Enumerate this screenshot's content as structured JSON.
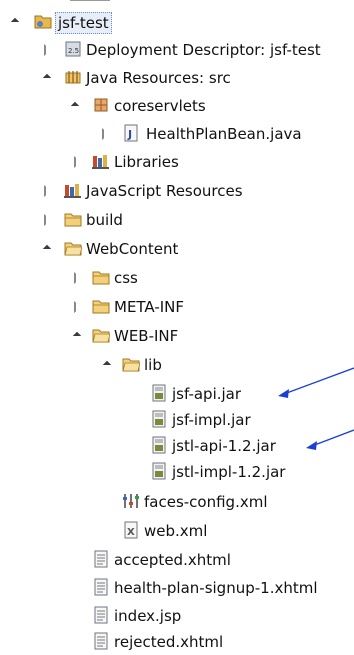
{
  "tree": {
    "project": "jsf-test",
    "deployment_descriptor": "Deployment Descriptor: jsf-test",
    "java_resources": "Java Resources: src",
    "package": "coreservlets",
    "java_file": "HealthPlanBean.java",
    "libraries": "Libraries",
    "js_resources": "JavaScript Resources",
    "build": "build",
    "webcontent": "WebContent",
    "css": "css",
    "meta_inf": "META-INF",
    "web_inf": "WEB-INF",
    "lib": "lib",
    "jars": [
      "jsf-api.jar",
      "jsf-impl.jar",
      "jstl-api-1.2.jar",
      "jstl-impl-1.2.jar"
    ],
    "faces_config": "faces-config.xml",
    "web_xml": "web.xml",
    "files": [
      "accepted.xhtml",
      "health-plan-signup-1.xhtml",
      "index.jsp",
      "rejected.xhtml"
    ]
  },
  "icons": {
    "project": "project-folder-icon",
    "deployment_descriptor": "descriptor-icon",
    "java_resources": "java-resources-icon",
    "package": "package-icon",
    "java_file": "java-file-icon",
    "libraries": "libraries-icon",
    "folder": "folder-icon",
    "jar": "jar-icon",
    "xml_config": "config-xml-icon",
    "xml": "xml-file-icon",
    "page": "page-file-icon"
  },
  "colors": {
    "arrow": "#1a3fd6",
    "folder": "#e8b84a",
    "selection_border": "#6a8ccf"
  }
}
